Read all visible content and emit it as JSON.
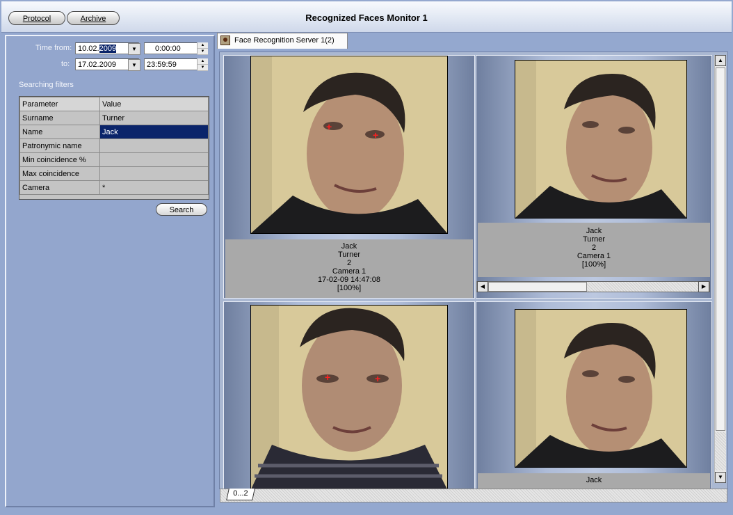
{
  "window": {
    "title": "Recognized Faces Monitor 1"
  },
  "toolbar": {
    "protocol_label": "Protocol",
    "archive_label": "Archive"
  },
  "search": {
    "time_from_label": "Time from:",
    "time_from_date_prefix": "10.02.",
    "time_from_date_selected": "2009",
    "time_from_time": "0:00:00",
    "to_label": "to:",
    "to_date": "17.02.2009",
    "to_time": "23:59:59",
    "filters_label": "Searching filters",
    "search_button": "Search"
  },
  "filters_table": {
    "headers": [
      "Parameter",
      "Value"
    ],
    "rows": [
      {
        "parameter": "Surname",
        "value": "Turner"
      },
      {
        "parameter": "Name",
        "value": "Jack"
      },
      {
        "parameter": "Patronymic name",
        "value": ""
      },
      {
        "parameter": "Min coincidence %",
        "value": ""
      },
      {
        "parameter": "Max coincidence",
        "value": ""
      },
      {
        "parameter": "Camera",
        "value": "*"
      }
    ]
  },
  "server_tab": {
    "label": "Face Recognition Server 1(2)"
  },
  "results": [
    {
      "name": "Jack",
      "surname": "Turner",
      "id": "2",
      "camera": "Camera 1",
      "timestamp": "17-02-09 14:47:08",
      "coincidence": "[100%]"
    },
    {
      "name": "Jack",
      "surname": "Turner",
      "id": "2",
      "camera": "Camera 1",
      "coincidence": "[100%]"
    },
    {
      "name": ""
    },
    {
      "name": "Jack"
    }
  ],
  "pager": {
    "label": "0...2"
  },
  "colors": {
    "selection": "#0a246a",
    "panel": "#93a6cd"
  }
}
